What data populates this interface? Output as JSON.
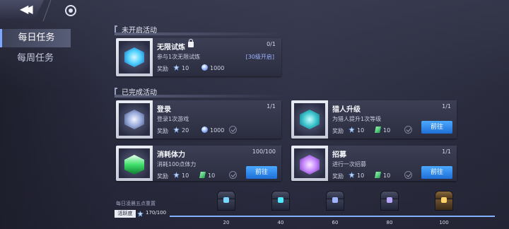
{
  "colors": {
    "accent": "#4aa9ff",
    "progress_fill": "#7fb1ff",
    "diamond": "#4fd2ff",
    "green_energy": "#3fe06a",
    "recruit_purple": "#c88cff"
  },
  "tabs": [
    {
      "label": "每日任务",
      "active": true
    },
    {
      "label": "每周任务",
      "active": false
    }
  ],
  "sections": {
    "not_started": "未开启活动",
    "completed": "已完成活动"
  },
  "cards": {
    "infinite_trial": {
      "title": "无限试炼",
      "desc": "参与1次无限试炼",
      "progress": "0/1",
      "tag": "[30级开启]",
      "reward_label": "奖励",
      "reward_1": "10",
      "reward_2": "1000",
      "icon": "diamond-icon"
    },
    "login": {
      "title": "登录",
      "desc": "登录1次游戏",
      "progress": "1/1",
      "reward_label": "奖励",
      "reward_1": "20",
      "reward_2": "1000",
      "icon": "star-emblem-icon"
    },
    "hunter_upgrade": {
      "title": "猎人升级",
      "desc": "为猎人提升1次等级",
      "progress": "1/1",
      "reward_label": "奖励",
      "reward_1": "10",
      "reward_2": "10",
      "button": "前往",
      "icon": "card-book-icon"
    },
    "stamina": {
      "title": "消耗体力",
      "desc": "消耗100点体力",
      "progress": "100/100",
      "reward_label": "奖励",
      "reward_1": "10",
      "reward_2": "10",
      "button": "前往",
      "icon": "stamina-potion-icon"
    },
    "recruit": {
      "title": "招募",
      "desc": "进行一次招募",
      "progress": "1/1",
      "reward_label": "奖励",
      "reward_1": "10",
      "reward_2": "10",
      "button": "前往",
      "icon": "recruit-icon"
    }
  },
  "activity": {
    "reset_note": "每日凌晨五点重置",
    "label": "活跃度",
    "value": "170/100",
    "fill_fraction": 1.0,
    "chests": [
      "20",
      "40",
      "60",
      "80",
      "100"
    ]
  }
}
